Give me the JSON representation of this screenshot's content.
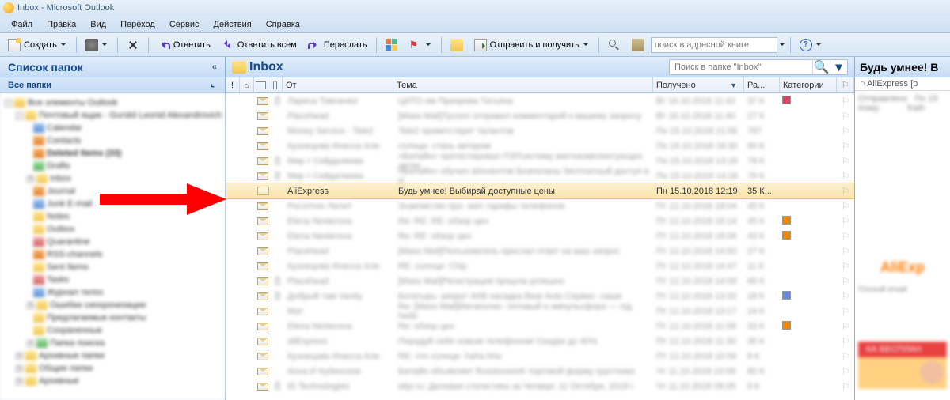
{
  "title": "Inbox - Microsoft Outlook",
  "menu": {
    "file": "Файл",
    "edit": "Правка",
    "view": "Вид",
    "go": "Переход",
    "tools": "Сервис",
    "actions": "Действия",
    "help": "Справка"
  },
  "toolbar": {
    "new": "Создать",
    "reply": "Ответить",
    "reply_all": "Ответить всем",
    "forward": "Переслать",
    "send_receive": "Отправить и получить",
    "search_placeholder": "поиск в адресной книге"
  },
  "left": {
    "title": "Список папок",
    "sub": "Все папки"
  },
  "inbox": {
    "title": "Inbox",
    "search_placeholder": "Поиск в папке \"Inbox\"",
    "columns": {
      "from": "От",
      "subject": "Тема",
      "received": "Получено",
      "size": "Ра...",
      "categories": "Категории"
    },
    "selected": {
      "from": "AliExpress",
      "subject": "Будь умнее! Выбирай доступные цены",
      "received": "Пн 15.10.2018 12:19",
      "size": "35 К..."
    }
  },
  "preview": {
    "title": "Будь умнее! В",
    "from": "AliExpress [p"
  },
  "blur_rows": [
    {
      "from": "Лариса Тимченко",
      "subj": "ЦИТО им Приорова Татьяна",
      "date": "Вт 16.10.2018 11:42",
      "size": "37 К",
      "cat": "#d46"
    },
    {
      "from": "Placehead",
      "subj": "[Mass Mail]Tycoon отправил комментарий к вашему запросу",
      "date": "Вт 16.10.2018 11:40",
      "size": "27 К",
      "cat": ""
    },
    {
      "from": "Money Service - Tele2",
      "subj": "Tele2 приветствует талантов",
      "date": "Пн 15.10.2018 21:56",
      "size": "787",
      "cat": ""
    },
    {
      "from": "Кузнецова Инесса Але",
      "subj": "солнце- стань автором",
      "date": "Пн 15.10.2018 16:30",
      "size": "90 К",
      "cat": ""
    },
    {
      "from": "Мир т Сейдалиева",
      "subj": "«Билайн» протестировал ПЭТсистему виктокомплектующих детек",
      "date": "Пн 15.10.2018 13:18",
      "size": "78 К",
      "cat": ""
    },
    {
      "from": "Мир т Сейдалиева",
      "subj": "«Билайн» обучил абонентов Бозполаны бесплатный доступ в И",
      "date": "Пн 15.10.2018 13:18",
      "size": "78 К",
      "cat": ""
    }
  ],
  "blur_rows2": [
    {
      "from": "Росэлтон Лилит",
      "subj": "Знакомство про- жел тарифы телефонов",
      "date": "Пт 12.10.2018 18:04",
      "size": "45 К",
      "cat": ""
    },
    {
      "from": "Elena Nesterova",
      "subj": "Re: RE: RE: обзор цен",
      "date": "Пт 12.10.2018 16:14",
      "size": "45 К",
      "cat": "#e80"
    },
    {
      "from": "Elena Nesterova",
      "subj": "Re: RE: обзор цен",
      "date": "Пт 12.10.2018 16:06",
      "size": "43 К",
      "cat": "#e80"
    },
    {
      "from": "Placehead",
      "subj": "[Mass Mail]Пользователь прислал ответ на ваш запрос",
      "date": "Пт 12.10.2018 14:50",
      "size": "27 К",
      "cat": ""
    },
    {
      "from": "Кузнецова Инесса Але",
      "subj": "RE: солнце- Chip",
      "date": "Пт 12.10.2018 14:47",
      "size": "11 К",
      "cat": ""
    },
    {
      "from": "Placehead",
      "subj": "[Mass Mail]Регистрация прошла успешно",
      "date": "Пт 12.10.2018 14:09",
      "size": "66 К",
      "cat": ""
    },
    {
      "from": "Добрый там Vanity",
      "subj": "Богатырь- рекрут АКВ насадка Bear Auto Сервис- наше",
      "date": "Пт 12.10.2018 13:32",
      "size": "18 К",
      "cat": "#68d"
    },
    {
      "from": "Мат",
      "subj": "Re: [Mass Mail]Мегаполис- оптовый и импульсфоро — під hedo",
      "date": "Пт 12.10.2018 13:17",
      "size": "24 К",
      "cat": ""
    },
    {
      "from": "Elena Nesterova",
      "subj": "Re: обзор цен",
      "date": "Пт 12.10.2018 11:58",
      "size": "33 К",
      "cat": "#e80"
    },
    {
      "from": "aliExpress",
      "subj": "Порадуй себя новым телефоном! Скидки до 40%",
      "date": "Пт 12.10.2018 11:30",
      "size": "35 К",
      "cat": ""
    },
    {
      "from": "Кузнецова Инесса Але",
      "subj": "RE: что солнце- haha hha",
      "date": "Пт 12.10.2018 10:56",
      "size": "8 К",
      "cat": ""
    },
    {
      "from": "Анна И Кубенское",
      "subj": "Билайн объявляет Russionwork торговой форму грустники",
      "date": "Чт 11.10.2018 10:09",
      "size": "80 К",
      "cat": ""
    },
    {
      "from": "ID Technologies",
      "subj": "eliyr.ru: Деловая статистика за Четверг, 11 Октября, 2018 г.",
      "date": "Чт 11.10.2018 09:05",
      "size": "9 К",
      "cat": ""
    }
  ]
}
